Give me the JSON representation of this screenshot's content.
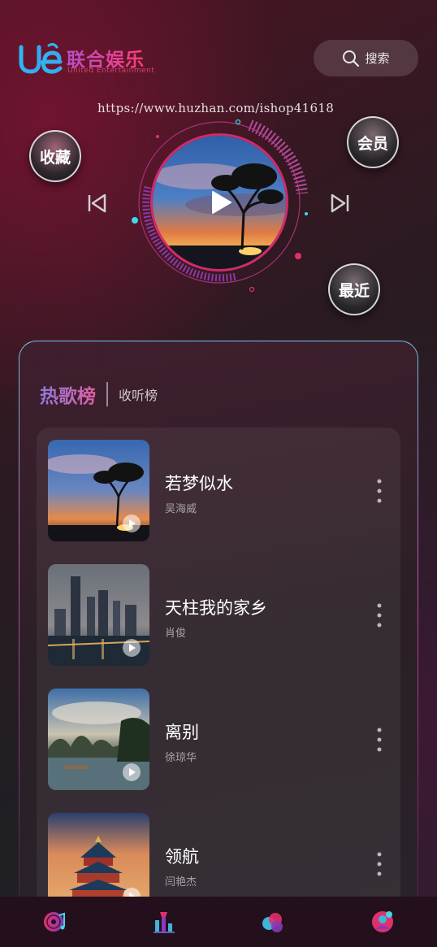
{
  "header": {
    "logo_title": "联合娱乐",
    "logo_sub": "United Entertainment",
    "search_label": "搜索"
  },
  "watermark": "https://www.huzhan.com/ishop41618",
  "shortcuts": {
    "favorites": "收藏",
    "vip": "会员",
    "recent": "最近"
  },
  "charts": {
    "tab_hot": "热歌榜",
    "tab_listen": "收听榜"
  },
  "songs": [
    {
      "title": "若梦似水",
      "artist": "吴海威"
    },
    {
      "title": "天柱我的家乡",
      "artist": "肖俊"
    },
    {
      "title": "离别",
      "artist": "徐琼华"
    },
    {
      "title": "领航",
      "artist": "闫艳杰"
    }
  ],
  "nav": [
    "music-disc-icon",
    "ranking-icon",
    "discover-icon",
    "profile-icon"
  ],
  "colors": {
    "accent": "#d12a6c",
    "accent2": "#c04fa0",
    "cyan": "#3fd8e8"
  }
}
